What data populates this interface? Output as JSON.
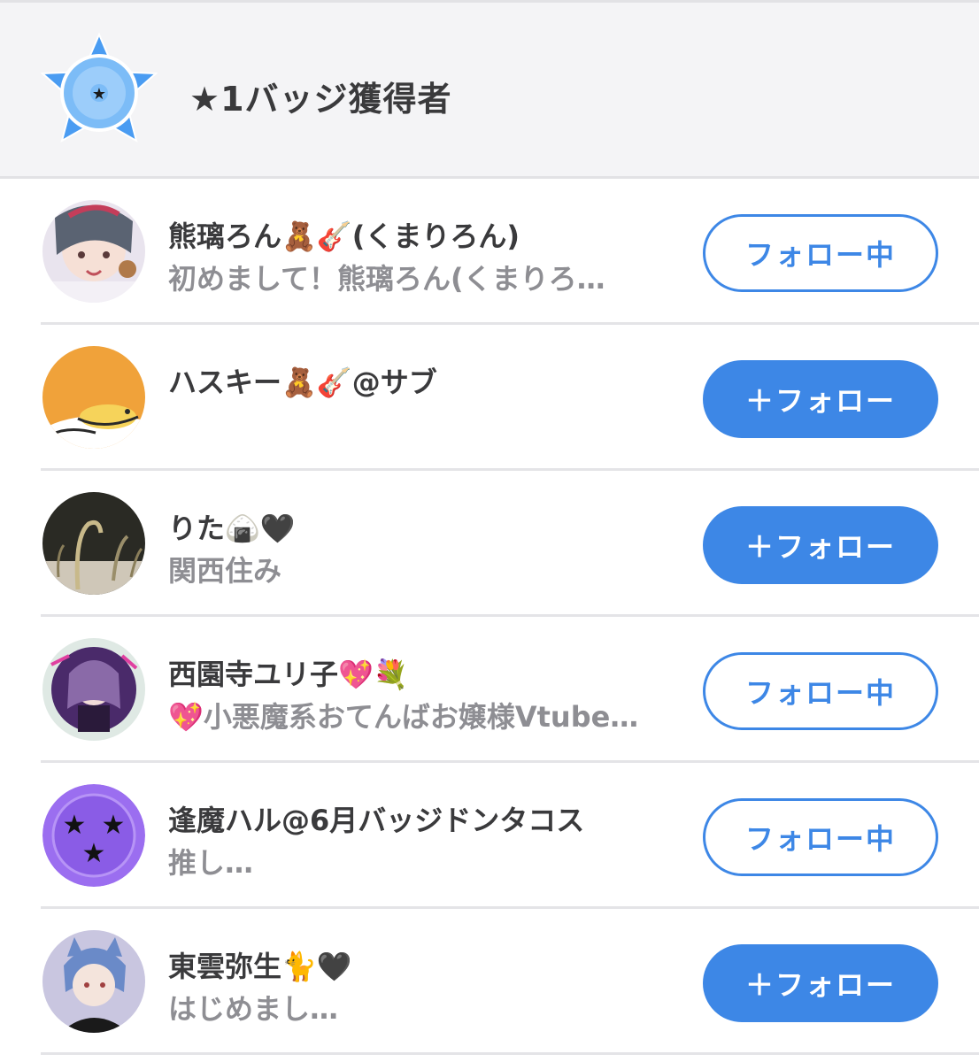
{
  "header": {
    "title": "★1バッジ獲得者",
    "badge_color": "#4a9cf2"
  },
  "users": [
    {
      "name": "熊璃ろん🧸🎸(くまりろん)",
      "bio": "初めまして！熊璃ろん(くまりろ…",
      "button": "フォロー中",
      "following": true
    },
    {
      "name": "ハスキー🧸🎸@サブ",
      "bio": "",
      "button": "＋フォロー",
      "following": false
    },
    {
      "name": "りた🍙🖤",
      "bio": "関西住み",
      "button": "＋フォロー",
      "following": false
    },
    {
      "name": "西園寺ユリ子💖💐",
      "bio": "💖小悪魔系おてんばお嬢様Vtube…",
      "button": "フォロー中",
      "following": true
    },
    {
      "name": "逢魔ハル@6月バッジドンタコス",
      "bio": "推し…",
      "button": "フォロー中",
      "following": true
    },
    {
      "name": "東雲弥生🐈🖤",
      "bio": "はじめまし…",
      "button": "＋フォロー",
      "following": false
    }
  ],
  "colors": {
    "accent": "#3d87e6",
    "header_bg": "#f4f4f6",
    "separator": "#e4e4e7",
    "bio_text": "#8e8e93"
  }
}
